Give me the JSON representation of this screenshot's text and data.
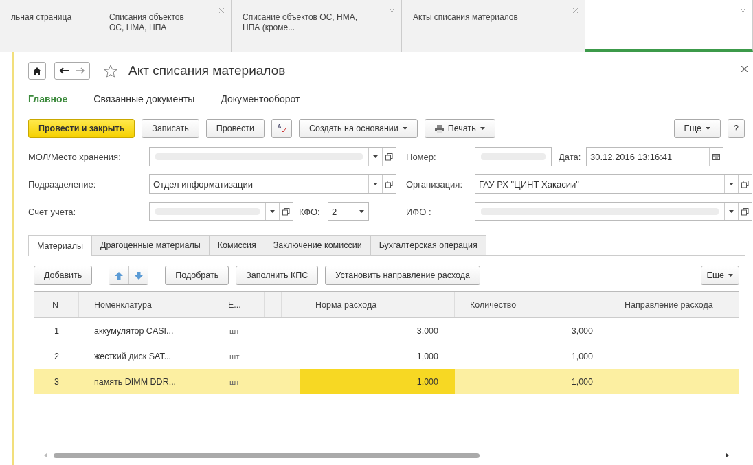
{
  "window_tabs": [
    {
      "label": "льная страница",
      "closable": false,
      "selected": false
    },
    {
      "label": "Списания объектов ОС, НМА, НПА",
      "closable": true,
      "selected": false
    },
    {
      "label": "Списание объектов ОС, НМА, НПА (кроме...",
      "closable": true,
      "selected": false
    },
    {
      "label": "Акты списания материалов",
      "closable": true,
      "selected": false
    },
    {
      "closable": true,
      "selected": true
    }
  ],
  "form": {
    "title": "Акт списания материалов",
    "favorite": false,
    "sections": [
      {
        "label": "Главное",
        "selected": true
      },
      {
        "label": "Связанные документы",
        "selected": false
      },
      {
        "label": "Документооборот",
        "selected": false
      }
    ],
    "toolbar_left": [
      {
        "kind": "primary",
        "label": "Провести и закрыть"
      },
      {
        "kind": "plain",
        "label": "Записать"
      },
      {
        "kind": "plain",
        "label": "Провести"
      },
      {
        "kind": "spell"
      },
      {
        "kind": "menu",
        "label": "Создать на основании"
      },
      {
        "kind": "print",
        "label": "Печать"
      }
    ],
    "toolbar_right": [
      {
        "kind": "menu",
        "label": "Еще"
      },
      {
        "kind": "plain",
        "label": "?"
      }
    ],
    "fields": {
      "mol": {
        "label": "МОЛ/Место хранения:"
      },
      "number": {
        "label": "Номер:"
      },
      "date": {
        "label": "Дата:",
        "value": "30.12.2016 13:16:41"
      },
      "department": {
        "label": "Подразделение:",
        "value": "Отдел информатизации"
      },
      "organization": {
        "label": "Организация:",
        "value": "ГАУ РХ \"ЦИНТ Хакасии\""
      },
      "account": {
        "label": "Счет учета:"
      },
      "kfo": {
        "label": "КФО:",
        "value": "2"
      },
      "ifo": {
        "label": "ИФО :"
      }
    },
    "tabs": [
      {
        "label": "Материалы",
        "selected": true
      },
      {
        "label": "Драгоценные материалы",
        "selected": false
      },
      {
        "label": "Комиссия",
        "selected": false
      },
      {
        "label": "Заключение комиссии",
        "selected": false
      },
      {
        "label": "Бухгалтерская операция",
        "selected": false
      }
    ],
    "table_toolbar": {
      "add": "Добавить",
      "pick": "Подобрать",
      "fill": "Заполнить КПС",
      "direction": "Установить направление расхода",
      "more": "Еще"
    },
    "table": {
      "columns": [
        "N",
        "Номенклатура",
        "Е...",
        "Норма расхода",
        "Количество",
        "Направление расхода"
      ],
      "rows": [
        {
          "n": "1",
          "name": "аккумулятор CASI...",
          "unit": "шт",
          "norm": "3,000",
          "qty": "3,000",
          "selected": false,
          "norm_focused": false
        },
        {
          "n": "2",
          "name": "жесткий диск SAT...",
          "unit": "шт",
          "norm": "1,000",
          "qty": "1,000",
          "selected": false,
          "norm_focused": false
        },
        {
          "n": "3",
          "name": "память DIMM DDR...",
          "unit": "шт",
          "norm": "1,000",
          "qty": "1,000",
          "selected": true,
          "norm_focused": true
        }
      ]
    }
  }
}
